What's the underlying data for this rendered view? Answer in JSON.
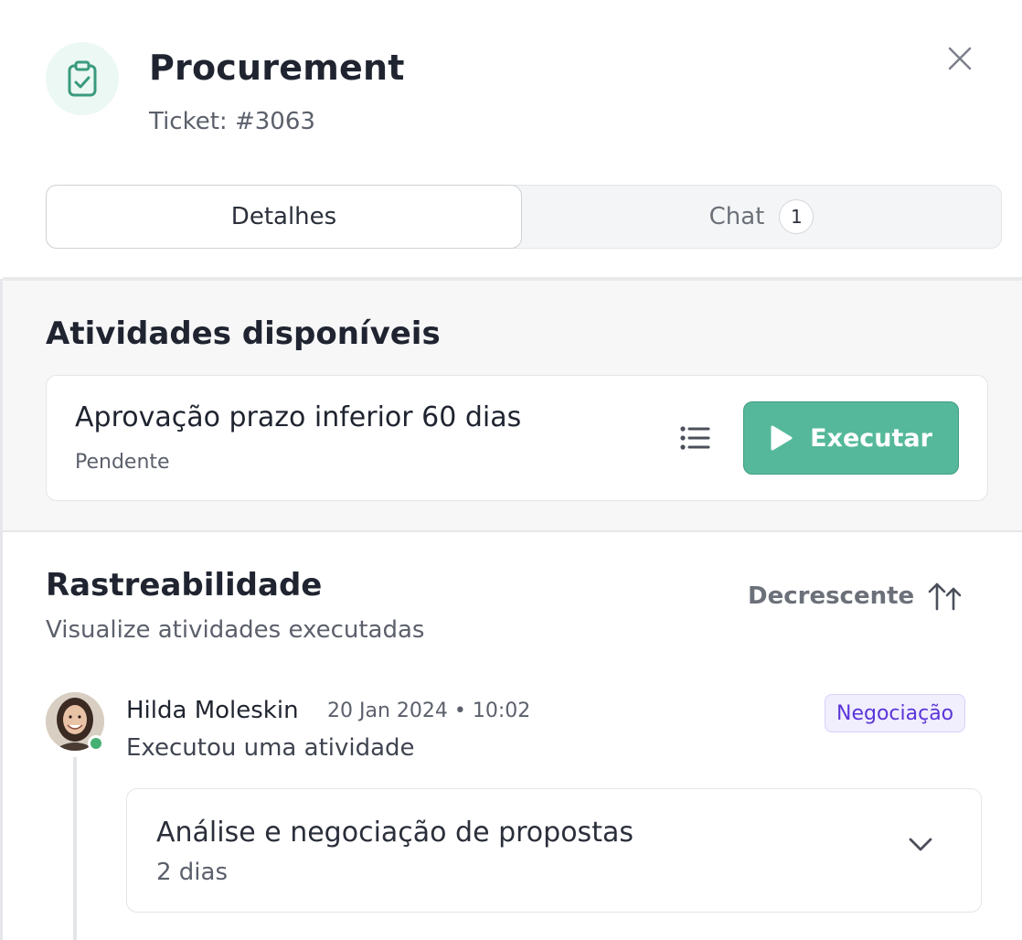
{
  "header": {
    "title": "Procurement",
    "ticket": "Ticket: #3063",
    "icon": "clipboard-check-icon",
    "close_icon": "close-icon"
  },
  "tabs": {
    "details_label": "Detalhes",
    "chat_label": "Chat",
    "chat_count": "1"
  },
  "activities": {
    "title": "Atividades disponíveis",
    "items": [
      {
        "name": "Aprovação prazo inferior 60 dias",
        "status": "Pendente",
        "action_label": "Executar"
      }
    ]
  },
  "traceability": {
    "title": "Rastreabilidade",
    "subtitle": "Visualize atividades executadas",
    "sort_label": "Decrescente",
    "events": [
      {
        "user": "Hilda Moleskin",
        "datetime": "20 Jan 2024 • 10:02",
        "tag": "Negociação",
        "description": "Executou uma atividade",
        "activity_name": "Análise e negociação de propostas",
        "duration": "2 dias"
      }
    ]
  },
  "colors": {
    "accent_green": "#55b89a",
    "tag_purple": "#5a35d8",
    "online": "#46b072"
  }
}
